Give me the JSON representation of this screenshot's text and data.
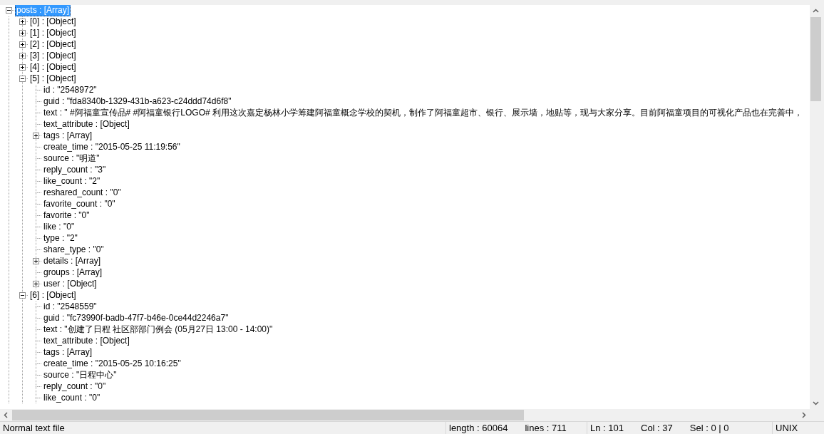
{
  "tree": [
    {
      "kind": "branch",
      "text": "posts : [Array]",
      "selected": true,
      "expanded": true,
      "children": [
        {
          "kind": "branch",
          "text": "[0] : [Object]",
          "selected": false,
          "expanded": false
        },
        {
          "kind": "branch",
          "text": "[1] : [Object]",
          "selected": false,
          "expanded": false
        },
        {
          "kind": "branch",
          "text": "[2] : [Object]",
          "selected": false,
          "expanded": false
        },
        {
          "kind": "branch",
          "text": "[3] : [Object]",
          "selected": false,
          "expanded": false
        },
        {
          "kind": "branch",
          "text": "[4] : [Object]",
          "selected": false,
          "expanded": false
        },
        {
          "kind": "branch",
          "text": "[5] : [Object]",
          "selected": false,
          "expanded": true,
          "children": [
            {
              "kind": "leaf",
              "text": "id : \"2548972\"",
              "selected": false
            },
            {
              "kind": "leaf",
              "text": "guid : \"fda8340b-1329-431b-a623-c24ddd74d6f8\"",
              "selected": false
            },
            {
              "kind": "leaf",
              "text": "text : \" #阿福童宣传品#   #阿福童银行LOGO#  利用这次嘉定杨林小学筹建阿福童概念学校的契机，制作了阿福童超市、银行、展示墙，地贴等，现与大家分享。目前阿福童项目的可视化产品也在完善中，",
              "selected": false
            },
            {
              "kind": "leaf",
              "text": "text_attribute : [Object]",
              "selected": false
            },
            {
              "kind": "branch",
              "text": "tags : [Array]",
              "selected": false,
              "expanded": false
            },
            {
              "kind": "leaf",
              "text": "create_time : \"2015-05-25 11:19:56\"",
              "selected": false
            },
            {
              "kind": "leaf",
              "text": "source : \"明道\"",
              "selected": false
            },
            {
              "kind": "leaf",
              "text": "reply_count : \"3\"",
              "selected": false
            },
            {
              "kind": "leaf",
              "text": "like_count : \"2\"",
              "selected": false
            },
            {
              "kind": "leaf",
              "text": "reshared_count : \"0\"",
              "selected": false
            },
            {
              "kind": "leaf",
              "text": "favorite_count : \"0\"",
              "selected": false
            },
            {
              "kind": "leaf",
              "text": "favorite : \"0\"",
              "selected": false
            },
            {
              "kind": "leaf",
              "text": "like : \"0\"",
              "selected": false
            },
            {
              "kind": "leaf",
              "text": "type : \"2\"",
              "selected": false
            },
            {
              "kind": "leaf",
              "text": "share_type : \"0\"",
              "selected": false
            },
            {
              "kind": "branch",
              "text": "details : [Array]",
              "selected": false,
              "expanded": false
            },
            {
              "kind": "leaf",
              "text": "groups : [Array]",
              "selected": false
            },
            {
              "kind": "branch",
              "text": "user : [Object]",
              "selected": false,
              "expanded": false
            }
          ]
        },
        {
          "kind": "branch",
          "text": "[6] : [Object]",
          "selected": false,
          "expanded": true,
          "children": [
            {
              "kind": "leaf",
              "text": "id : \"2548559\"",
              "selected": false
            },
            {
              "kind": "leaf",
              "text": "guid : \"fc73990f-badb-47f7-b46e-0ce44d2246a7\"",
              "selected": false
            },
            {
              "kind": "leaf",
              "text": "text : \"创建了日程 社区部部门例会 (05月27日 13:00 - 14:00)\"",
              "selected": false
            },
            {
              "kind": "leaf",
              "text": "text_attribute : [Object]",
              "selected": false
            },
            {
              "kind": "leaf",
              "text": "tags : [Array]",
              "selected": false
            },
            {
              "kind": "leaf",
              "text": "create_time : \"2015-05-25 10:16:25\"",
              "selected": false
            },
            {
              "kind": "leaf",
              "text": "source : \"日程中心\"",
              "selected": false
            },
            {
              "kind": "leaf",
              "text": "reply_count : \"0\"",
              "selected": false
            },
            {
              "kind": "leaf",
              "text": "like_count : \"0\"",
              "selected": false
            }
          ]
        }
      ]
    }
  ],
  "status_bar": {
    "file_type": "Normal text file",
    "length": "length : 60064",
    "lines": "lines : 711",
    "line": "Ln : 101",
    "column": "Col : 37",
    "selection": "Sel : 0 | 0",
    "eol": "UNIX"
  }
}
